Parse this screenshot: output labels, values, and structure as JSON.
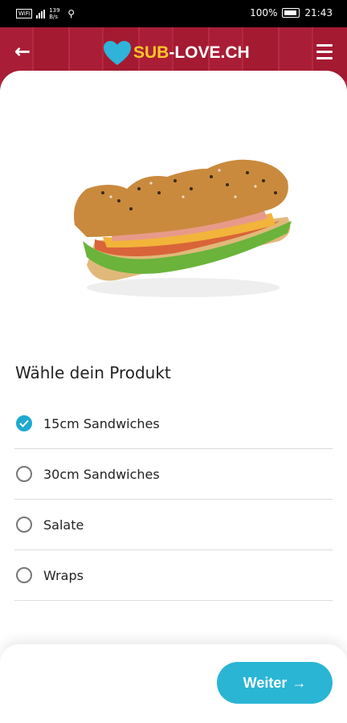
{
  "status_bar": {
    "wifi_label": "WiFi",
    "network_speed": "139 B/s",
    "battery_percent": "100%",
    "time": "21:43"
  },
  "header": {
    "logo_part1": "SUB",
    "logo_part2": "-LOVE.CH",
    "back_icon": "arrow-left-icon",
    "menu_icon": "hamburger-menu-icon",
    "logo_heart_color": "#2fb3d8"
  },
  "content": {
    "title": "Wähle dein Produkt",
    "options": [
      {
        "label": "15cm Sandwiches",
        "selected": true
      },
      {
        "label": "30cm Sandwiches",
        "selected": false
      },
      {
        "label": "Salate",
        "selected": false
      },
      {
        "label": "Wraps",
        "selected": false
      }
    ]
  },
  "footer": {
    "next_label": "Weiter",
    "next_icon": "arrow-right-icon"
  },
  "colors": {
    "accent": "#2ab5d4",
    "header_bg": "#a91e36",
    "logo_highlight": "#ffc629"
  }
}
